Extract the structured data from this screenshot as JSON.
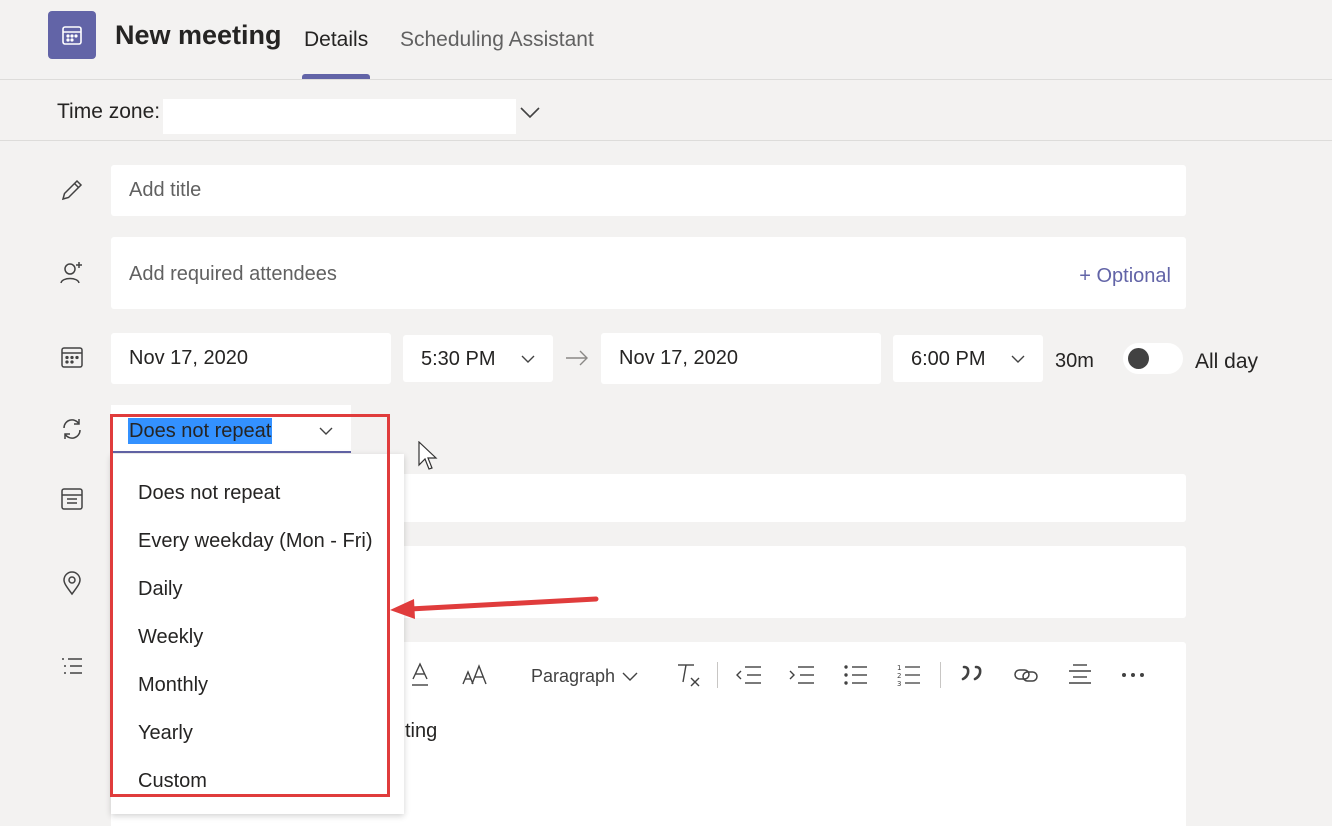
{
  "header": {
    "title": "New meeting",
    "tabs": [
      {
        "label": "Details",
        "active": true
      },
      {
        "label": "Scheduling Assistant",
        "active": false
      }
    ]
  },
  "timezone": {
    "label": "Time zone:",
    "value": ""
  },
  "form": {
    "title_placeholder": "Add title",
    "attendees_placeholder": "Add required attendees",
    "optional_link": "+ Optional",
    "start_date": "Nov 17, 2020",
    "start_time": "5:30 PM",
    "end_date": "Nov 17, 2020",
    "end_time": "6:00 PM",
    "duration": "30m",
    "all_day_label": "All day",
    "all_day_on": false,
    "repeat_value": "Does not repeat",
    "details_fragment": "ting"
  },
  "repeat_menu": {
    "items": [
      "Does not repeat",
      "Every weekday (Mon - Fri)",
      "Daily",
      "Weekly",
      "Monthly",
      "Yearly",
      "Custom"
    ]
  },
  "toolbar": {
    "paragraph_label": "Paragraph"
  },
  "colors": {
    "accent": "#6264a7",
    "selection": "#3391ff",
    "annotation": "#e03c3c"
  }
}
